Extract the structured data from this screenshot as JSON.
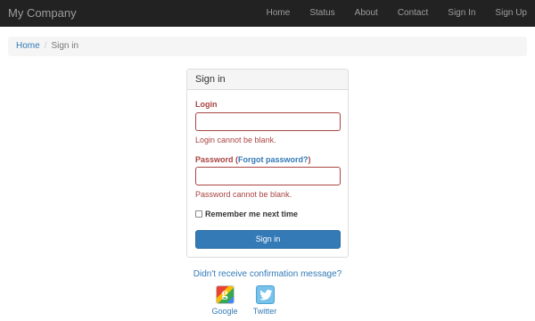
{
  "navbar": {
    "brand": "My Company",
    "links": [
      "Home",
      "Status",
      "About",
      "Contact",
      "Sign In",
      "Sign Up"
    ]
  },
  "breadcrumb": {
    "home": "Home",
    "separator": "/",
    "current": "Sign in"
  },
  "signin_panel": {
    "title": "Sign in",
    "login_label": "Login",
    "login_value": "",
    "login_error": "Login cannot be blank.",
    "password_label": "Password",
    "password_paren_open": " (",
    "forgot_password": "Forgot password?",
    "password_paren_close": ")",
    "password_value": "",
    "password_error": "Password cannot be blank.",
    "remember_label": "Remember me next time",
    "remember_checked": false,
    "submit_label": "Sign in"
  },
  "resend_confirmation": "Didn't receive confirmation message?",
  "social": {
    "google": {
      "label": "Google",
      "icon": "google-icon"
    },
    "twitter": {
      "label": "Twitter",
      "icon": "twitter-icon"
    }
  },
  "colors": {
    "navbar_bg": "#222222",
    "link": "#337ab7",
    "error": "#a94442",
    "primary_button": "#337ab7"
  }
}
